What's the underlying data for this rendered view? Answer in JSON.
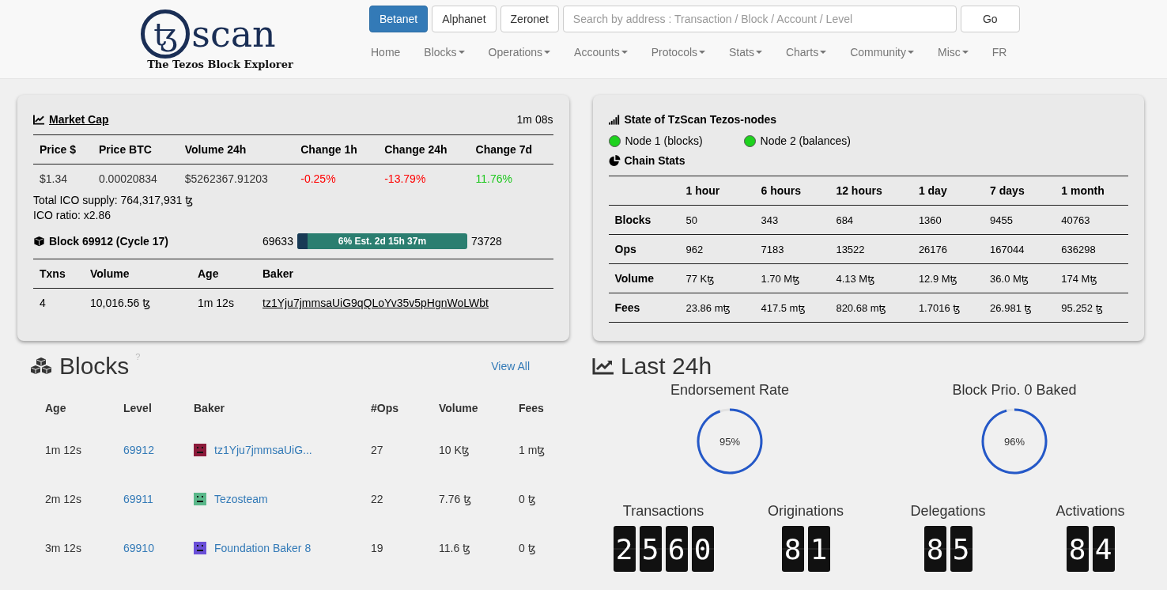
{
  "header": {
    "logo": {
      "mark": "ꜩ",
      "name": "scan",
      "tagline": "The Tezos Block Explorer"
    },
    "networks": [
      {
        "label": "Betanet",
        "selected": true
      },
      {
        "label": "Alphanet",
        "selected": false
      },
      {
        "label": "Zeronet",
        "selected": false
      }
    ],
    "search": {
      "placeholder": "Search by address : Transaction / Block / Account / Level"
    },
    "go_button": "Go",
    "nav": [
      {
        "label": "Home",
        "dropdown": false
      },
      {
        "label": "Blocks",
        "dropdown": true
      },
      {
        "label": "Operations",
        "dropdown": true
      },
      {
        "label": "Accounts",
        "dropdown": true
      },
      {
        "label": "Protocols",
        "dropdown": true
      },
      {
        "label": "Stats",
        "dropdown": true
      },
      {
        "label": "Charts",
        "dropdown": true
      },
      {
        "label": "Community",
        "dropdown": true
      },
      {
        "label": "Misc",
        "dropdown": true
      },
      {
        "label": "FR",
        "dropdown": false
      }
    ]
  },
  "market": {
    "title": "Market Cap",
    "updated": "1m 08s",
    "columns": [
      "Price $",
      "Price BTC",
      "Volume 24h",
      "Change 1h",
      "Change 24h",
      "Change 7d"
    ],
    "cells": [
      {
        "text": "$1.34",
        "color": "#333333"
      },
      {
        "text": "0.00020834",
        "color": "#333333"
      },
      {
        "text": "$5262367.91203",
        "color": "#333333"
      },
      {
        "text": "-0.25%",
        "color": "#ff0000"
      },
      {
        "text": "-13.79%",
        "color": "#ff0000"
      },
      {
        "text": "11.76%",
        "color": "#1ec81e"
      }
    ],
    "supply": "Total ICO supply: 764,317,931 ꜩ",
    "ratio": "ICO ratio: x2.86"
  },
  "block": {
    "title": "Block 69912 (Cycle 17)",
    "start": "69633",
    "end": "73728",
    "progress": {
      "level": 0.06,
      "label": "6% Est. 2d 15h 37m"
    },
    "columns": [
      "Txns",
      "Volume",
      "Age",
      "Baker"
    ],
    "row": {
      "txns": "4",
      "volume": "10,016.56 ꜩ",
      "age": "1m 12s",
      "baker": "tz1Yju7jmmsaUiG9qQLoYv35v5pHgnWoLWbt"
    }
  },
  "nodes": {
    "title": "State of TzScan Tezos-nodes",
    "items": [
      {
        "label": "Node 1 (blocks)",
        "online": true
      },
      {
        "label": "Node 2 (balances)",
        "online": true
      }
    ],
    "stats_title": "Chain Stats",
    "columns": [
      "1 hour",
      "6 hours",
      "12 hours",
      "1 day",
      "7 days",
      "1 month"
    ],
    "rows": [
      {
        "label": "Blocks",
        "values": [
          "50",
          "343",
          "684",
          "1360",
          "9455",
          "40763"
        ]
      },
      {
        "label": "Ops",
        "values": [
          "962",
          "7183",
          "13522",
          "26176",
          "167044",
          "636298"
        ]
      },
      {
        "label": "Volume",
        "values": [
          "77 Kꜩ",
          "1.70 Mꜩ",
          "4.13 Mꜩ",
          "12.9 Mꜩ",
          "36.0 Mꜩ",
          "174 Mꜩ"
        ]
      },
      {
        "label": "Fees",
        "values": [
          "23.86 mꜩ",
          "417.5 mꜩ",
          "820.68 mꜩ",
          "1.7016 ꜩ",
          "26.981 ꜩ",
          "95.252 ꜩ"
        ]
      }
    ]
  },
  "blocks": {
    "title": "Blocks",
    "help": "?",
    "view_all": "View All",
    "columns": [
      "Age",
      "Level",
      "Baker",
      "#Ops",
      "Volume",
      "Fees"
    ],
    "rows": [
      {
        "age": "1m 12s",
        "level": "69912",
        "baker": "tz1Yju7jmmsaUiG...",
        "color": "#8b1a3a",
        "ops": "27",
        "volume": "10 Kꜩ",
        "fees": "1 mꜩ"
      },
      {
        "age": "2m 12s",
        "level": "69911",
        "baker": "Tezosteam",
        "color": "#5ab88a",
        "ops": "22",
        "volume": "7.76 ꜩ",
        "fees": "0 ꜩ"
      },
      {
        "age": "3m 12s",
        "level": "69910",
        "baker": "Foundation Baker 8",
        "color": "#6a4fd8",
        "ops": "19",
        "volume": "11.6 ꜩ",
        "fees": "0 ꜩ"
      }
    ]
  },
  "last24": {
    "title": "Last 24h",
    "gauges": [
      {
        "label": "Endorsement Rate",
        "level": 0.95,
        "reading": "95%"
      },
      {
        "label": "Block Prio. 0 Baked",
        "level": 0.96,
        "reading": "96%"
      }
    ],
    "counters": [
      {
        "label": "Transactions",
        "digits": [
          "2",
          "5",
          "6",
          "0"
        ]
      },
      {
        "label": "Originations",
        "digits": [
          "8",
          "1"
        ]
      },
      {
        "label": "Delegations",
        "digits": [
          "8",
          "5"
        ]
      },
      {
        "label": "Activations",
        "digits": [
          "8",
          "4"
        ]
      }
    ]
  }
}
